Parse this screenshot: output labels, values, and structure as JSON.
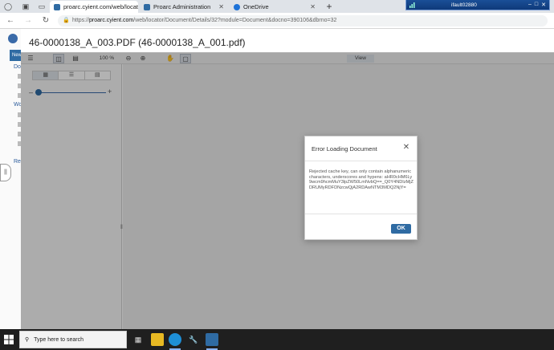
{
  "browser": {
    "tabs": [
      {
        "title": "proarc.cyient.com/web/locator/D",
        "icon": "proarc-favicon",
        "color": "#2f6ba3",
        "active": true
      },
      {
        "title": "Proarc Administration",
        "icon": "proarc-favicon",
        "color": "#2f6ba3",
        "active": false
      },
      {
        "title": "OneDrive",
        "icon": "onedrive-cloud-icon",
        "color": "#1e73d8",
        "active": false
      }
    ],
    "new_tab_label": "+",
    "url_prefix": "https://",
    "url_host": "proarc.cyient.com",
    "url_path": "/web/locator/Document/Details/32?module=Document&docno=390106&dbrno=32"
  },
  "remote_session": {
    "user": "ifault02880"
  },
  "app": {
    "new_button_label": "New",
    "nav_labels": [
      "Doc",
      "Wo",
      "Re"
    ],
    "document_title": "46-0000138_A_003.PDF (46-0000138_A_001.pdf)"
  },
  "viewer": {
    "zoom": "100 %",
    "view_tab_label": "View",
    "slider_value": 0.05
  },
  "dialog": {
    "title": "Error Loading Document",
    "message": "Rejected cache key, can only contain alphanumeric characters, underscores and hypens: aHR0cHM6Ly9wcm9hcmMuY3lpZW50LmNvbQ==_Q0Y4NDIzMjZDRUMyRDFDNzcwQjA2RDAwNTM3MDQ2NjY=",
    "ok_label": "OK"
  },
  "taskbar": {
    "search_placeholder": "Type here to search",
    "apps": [
      "task-view-icon",
      "file-explorer-icon",
      "edge-icon",
      "tools-icon",
      "proarc-app-icon"
    ]
  },
  "colors": {
    "accent": "#2f6ba3",
    "overlay": "rgba(0,0,0,0.30)",
    "taskbar": "#1f1f1f"
  }
}
